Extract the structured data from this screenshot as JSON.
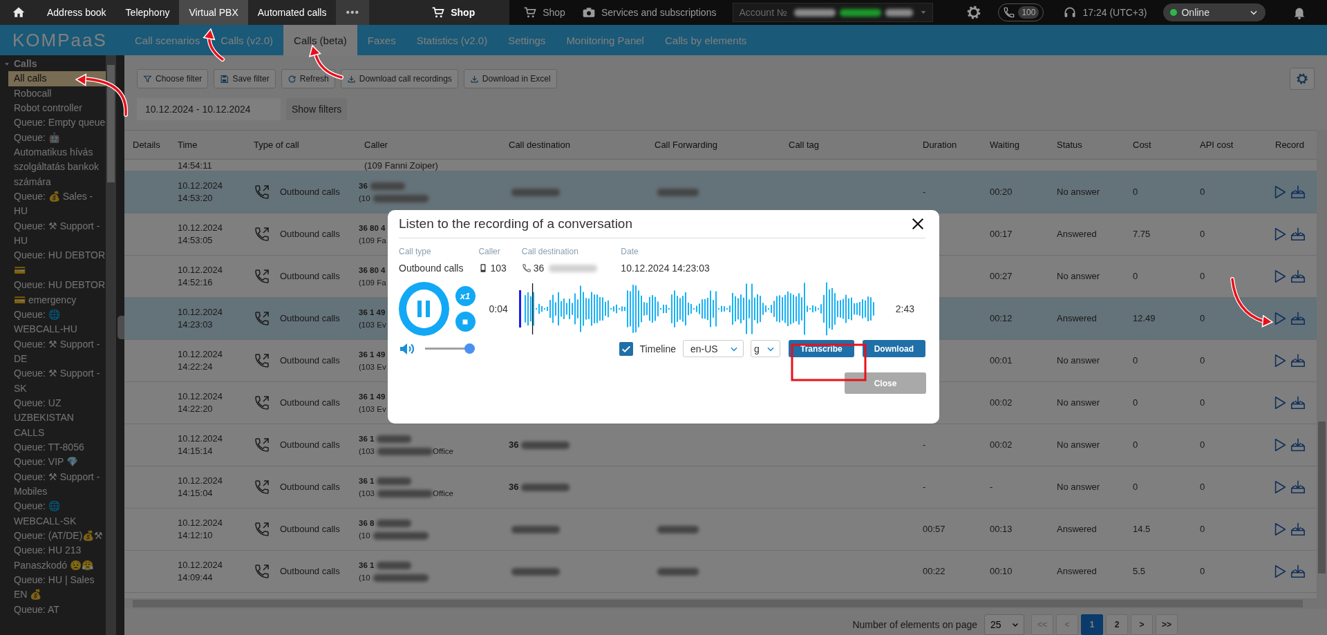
{
  "topbar": {
    "items": [
      {
        "label": "Address book",
        "selected": false
      },
      {
        "label": "Telephony",
        "selected": false
      },
      {
        "label": "Virtual PBX",
        "selected": true
      },
      {
        "label": "Automated calls",
        "selected": false
      }
    ],
    "more": "•••",
    "shop": "Shop",
    "shop_secondary": "Shop",
    "services": "Services and subscriptions",
    "account": "Account №",
    "lines_badge": "100",
    "time": "17:24 (UTC+3)",
    "status": "Online"
  },
  "nav": {
    "logo": "KOMPaaS",
    "tabs": [
      {
        "label": "Call scenarios",
        "selected": false
      },
      {
        "label": "Calls (v2.0)",
        "selected": false
      },
      {
        "label": "Calls (beta)",
        "selected": true
      },
      {
        "label": "Faxes",
        "selected": false
      },
      {
        "label": "Statistics (v2.0)",
        "selected": false
      },
      {
        "label": "Settings",
        "selected": false
      },
      {
        "label": "Monitoring Panel",
        "selected": false
      },
      {
        "label": "Calls by elements",
        "selected": false
      }
    ]
  },
  "sidebar": {
    "group": "Calls",
    "expanded": true,
    "items": [
      {
        "label": "All calls",
        "selected": true
      },
      {
        "label": "Robocall",
        "selected": false
      },
      {
        "label": "Robot controller",
        "selected": false
      },
      {
        "label": "Queue: Empty queue",
        "selected": false
      },
      {
        "label": "Queue: 🤖 Automatikus hívás szolgáltatás bankok számára",
        "selected": false
      },
      {
        "label": "Queue: 💰 Sales - HU",
        "selected": false
      },
      {
        "label": "Queue: ⚒ Support - HU",
        "selected": false
      },
      {
        "label": "Queue: HU DEBTOR 💳",
        "selected": false
      },
      {
        "label": "Queue: HU DEBTOR 💳 emergency",
        "selected": false
      },
      {
        "label": "Queue: 🌐 WEBCALL-HU",
        "selected": false
      },
      {
        "label": "Queue: ⚒ Support - DE",
        "selected": false
      },
      {
        "label": "Queue: ⚒ Support - SK",
        "selected": false
      },
      {
        "label": "Queue: UZ UZBEKISTAN CALLS",
        "selected": false
      },
      {
        "label": "Queue: TT-8056",
        "selected": false
      },
      {
        "label": "Queue: VIP 💎",
        "selected": false
      },
      {
        "label": "Queue: ⚒ Support - Mobiles",
        "selected": false
      },
      {
        "label": "Queue: 🌐 WEBCALL-SK",
        "selected": false
      },
      {
        "label": "Queue: (AT/DE)💰⚒",
        "selected": false
      },
      {
        "label": "Queue: HU 213 Panaszkodó 😟😤",
        "selected": false
      },
      {
        "label": "Queue: HU | Sales EN 💰",
        "selected": false
      },
      {
        "label": "Queue: AT",
        "selected": false
      }
    ]
  },
  "toolbar": {
    "buttons": [
      {
        "label": "Choose filter"
      },
      {
        "label": "Save filter"
      },
      {
        "label": "Refresh"
      },
      {
        "label": "Download call recordings"
      },
      {
        "label": "Download in Excel"
      }
    ],
    "date_range": "10.12.2024 - 10.12.2024",
    "show_filters": "Show filters"
  },
  "table": {
    "columns": [
      "Details",
      "Time",
      "Type of call",
      "Caller",
      "Call destination",
      "Call Forwarding",
      "Call tag",
      "Duration",
      "Waiting",
      "Status",
      "Cost",
      "API cost",
      "Record"
    ],
    "rows": [
      {
        "kind": "partial",
        "highlighted": false,
        "time": "14:54:11",
        "caller_name": "(109 Fanni Zoiper)"
      },
      {
        "kind": "full",
        "highlighted": true,
        "date": "10.12.2024",
        "time": "14:53:20",
        "type": "Outbound calls",
        "caller_number": "36",
        "number_redacted": true,
        "caller_name": "(10",
        "name_redacted": true,
        "destination_redacted": true,
        "forwarding_redacted": true,
        "duration": "-",
        "waiting": "00:20",
        "status": "No answer",
        "cost": "0",
        "api_cost": "0"
      },
      {
        "kind": "full",
        "highlighted": false,
        "date": "10.12.2024",
        "time": "14:53:05",
        "type": "Outbound calls",
        "caller_number": "36 80 4",
        "number_redacted": false,
        "caller_name": "(109 Fa",
        "name_redacted": false,
        "destination_redacted": false,
        "forwarding_redacted": false,
        "waiting": "00:17",
        "status": "Answered",
        "cost": "7.75",
        "api_cost": "0"
      },
      {
        "kind": "full",
        "highlighted": false,
        "date": "10.12.2024",
        "time": "14:52:16",
        "type": "Outbound calls",
        "caller_number": "36 80 4",
        "number_redacted": false,
        "caller_name": "(109 Fa",
        "name_redacted": false,
        "destination_redacted": false,
        "forwarding_redacted": false,
        "waiting": "00:27",
        "status": "No answer",
        "cost": "0",
        "api_cost": "0"
      },
      {
        "kind": "full",
        "highlighted": true,
        "date": "10.12.2024",
        "time": "14:23:03",
        "type": "Outbound calls",
        "caller_number": "36 1 49",
        "number_redacted": false,
        "caller_name": "(103 Ev",
        "name_redacted": false,
        "destination_redacted": false,
        "forwarding_redacted": false,
        "waiting": "00:12",
        "status": "Answered",
        "cost": "12.49",
        "api_cost": "0"
      },
      {
        "kind": "full",
        "highlighted": false,
        "date": "10.12.2024",
        "time": "14:22:24",
        "type": "Outbound calls",
        "caller_number": "36 1 49",
        "number_redacted": false,
        "caller_name": "(103 Ev",
        "name_redacted": false,
        "destination_redacted": false,
        "forwarding_redacted": false,
        "waiting": "00:01",
        "status": "No answer",
        "cost": "0",
        "api_cost": "0"
      },
      {
        "kind": "full",
        "highlighted": false,
        "date": "10.12.2024",
        "time": "14:22:20",
        "type": "Outbound calls",
        "caller_number": "36 1 49",
        "number_redacted": false,
        "caller_name": "(103 Ev",
        "name_redacted": false,
        "destination_redacted": false,
        "forwarding_redacted": false,
        "waiting": "00:02",
        "status": "No answer",
        "cost": "0",
        "api_cost": "0"
      },
      {
        "kind": "full",
        "highlighted": false,
        "date": "10.12.2024",
        "time": "14:15:14",
        "type": "Outbound calls",
        "caller_number": "36 1",
        "number_redacted": true,
        "caller_name": "(103",
        "name_redacted": true,
        "name_suffix": "Office",
        "destination": "36",
        "destination_redacted": true,
        "forwarding_redacted": false,
        "duration": "-",
        "waiting": "00:02",
        "status": "No answer",
        "cost": "0",
        "api_cost": "0"
      },
      {
        "kind": "full",
        "highlighted": false,
        "date": "10.12.2024",
        "time": "14:15:04",
        "type": "Outbound calls",
        "caller_number": "36 1",
        "number_redacted": true,
        "caller_name": "(103",
        "name_redacted": true,
        "name_suffix": "Office",
        "destination": "36",
        "destination_redacted": true,
        "forwarding_redacted": false,
        "duration": "-",
        "waiting": "-",
        "status": "No answer",
        "cost": "0",
        "api_cost": "0"
      },
      {
        "kind": "full",
        "highlighted": false,
        "date": "10.12.2024",
        "time": "14:12:10",
        "type": "Outbound calls",
        "caller_number": "36 8",
        "number_redacted": true,
        "caller_name": "(10",
        "name_redacted": true,
        "destination_redacted": true,
        "forwarding_redacted": true,
        "duration": "00:57",
        "waiting": "00:13",
        "status": "Answered",
        "cost": "14.5",
        "api_cost": "0"
      },
      {
        "kind": "full",
        "highlighted": false,
        "date": "10.12.2024",
        "time": "14:09:44",
        "type": "Outbound calls",
        "caller_number": "36 1",
        "number_redacted": true,
        "caller_name": "(10",
        "name_redacted": true,
        "destination_redacted": true,
        "forwarding_redacted": true,
        "duration": "00:22",
        "waiting": "00:10",
        "status": "Answered",
        "cost": "5.5",
        "api_cost": "0"
      }
    ]
  },
  "pagination": {
    "label": "Number of elements on page",
    "page_size": "25",
    "buttons": [
      {
        "label": "<<",
        "disabled": true,
        "selected": false
      },
      {
        "label": "<",
        "disabled": true,
        "selected": false
      },
      {
        "label": "1",
        "disabled": false,
        "selected": true
      },
      {
        "label": "2",
        "disabled": false,
        "selected": false
      },
      {
        "label": ">",
        "disabled": false,
        "selected": false
      },
      {
        "label": ">>",
        "disabled": false,
        "selected": false
      }
    ]
  },
  "dialog": {
    "title": "Listen to the recording of a conversation",
    "meta": [
      {
        "label": "Call type",
        "value": "Outbound calls"
      },
      {
        "label": "Caller",
        "value": "103"
      },
      {
        "label": "Call destination",
        "value": "36",
        "redacted": true
      },
      {
        "label": "Date",
        "value": "10.12.2024 14:23:03"
      }
    ],
    "player": {
      "playing": true,
      "speed": "x1",
      "elapsed": "0:04",
      "duration": "2:43",
      "level": 0.025
    },
    "volume": {
      "level": 1
    },
    "timeline": {
      "label": "Timeline",
      "checked": true
    },
    "language": "en-US",
    "model": "g",
    "transcribe": "Transcribe",
    "download": "Download",
    "close": "Close",
    "close_disabled": true
  }
}
